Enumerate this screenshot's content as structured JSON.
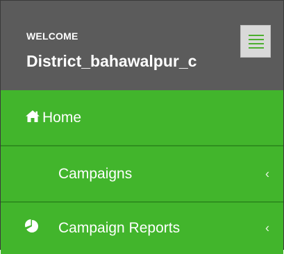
{
  "sidebar": {
    "header": {
      "welcome_label": "WELCOME",
      "username": "District_bahawalpur_c"
    },
    "toggle_icon": "hamburger-menu-icon",
    "items": [
      {
        "label": "Home",
        "icon": "home-icon",
        "chevron": ""
      },
      {
        "label": "Campaigns",
        "icon": "",
        "chevron": "‹"
      },
      {
        "label": "Campaign Reports",
        "icon": "pie-chart-icon",
        "chevron": "‹"
      }
    ]
  },
  "colors": {
    "header_bg": "#5b5b5b",
    "nav_bg": "#42b52c",
    "divider": "#2f8f1f",
    "toggle_bars": "#4caf2f"
  }
}
